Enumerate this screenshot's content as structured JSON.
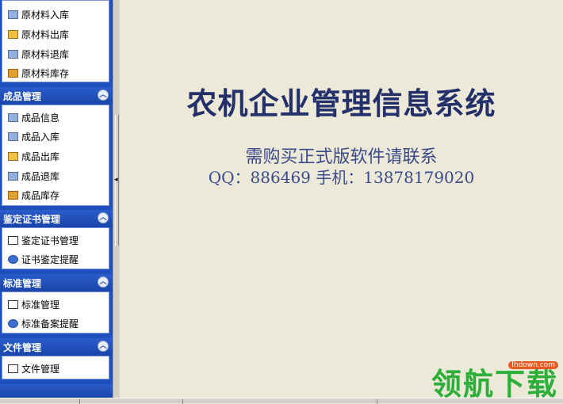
{
  "sidebar": {
    "top_items": [
      {
        "label": "原材料入库",
        "icon": "store-in-icon"
      },
      {
        "label": "原材料出库",
        "icon": "store-out-icon"
      },
      {
        "label": "原材料退库",
        "icon": "store-return-icon"
      },
      {
        "label": "原材料库存",
        "icon": "warehouse-icon"
      }
    ],
    "groups": [
      {
        "title": "成品管理",
        "items": [
          {
            "label": "成品信息",
            "icon": "info-icon"
          },
          {
            "label": "成品入库",
            "icon": "store-in-icon"
          },
          {
            "label": "成品出库",
            "icon": "store-out-icon"
          },
          {
            "label": "成品退库",
            "icon": "store-return-icon"
          },
          {
            "label": "成品库存",
            "icon": "warehouse-icon"
          }
        ]
      },
      {
        "title": "鉴定证书管理",
        "items": [
          {
            "label": "鉴定证书管理",
            "icon": "document-icon"
          },
          {
            "label": "证书鉴定提醒",
            "icon": "alert-icon"
          }
        ]
      },
      {
        "title": "标准管理",
        "items": [
          {
            "label": "标准管理",
            "icon": "document-icon"
          },
          {
            "label": "标准备案提醒",
            "icon": "alert-icon"
          }
        ]
      },
      {
        "title": "文件管理",
        "items": [
          {
            "label": "文件管理",
            "icon": "file-icon"
          }
        ]
      }
    ]
  },
  "main": {
    "title": "农机企业管理信息系统",
    "notice": "需购买正式版软件请联系",
    "contact": "QQ：886469   手机：13878179020"
  },
  "watermark": {
    "text": "领航下载",
    "site": "lhdown.com"
  }
}
